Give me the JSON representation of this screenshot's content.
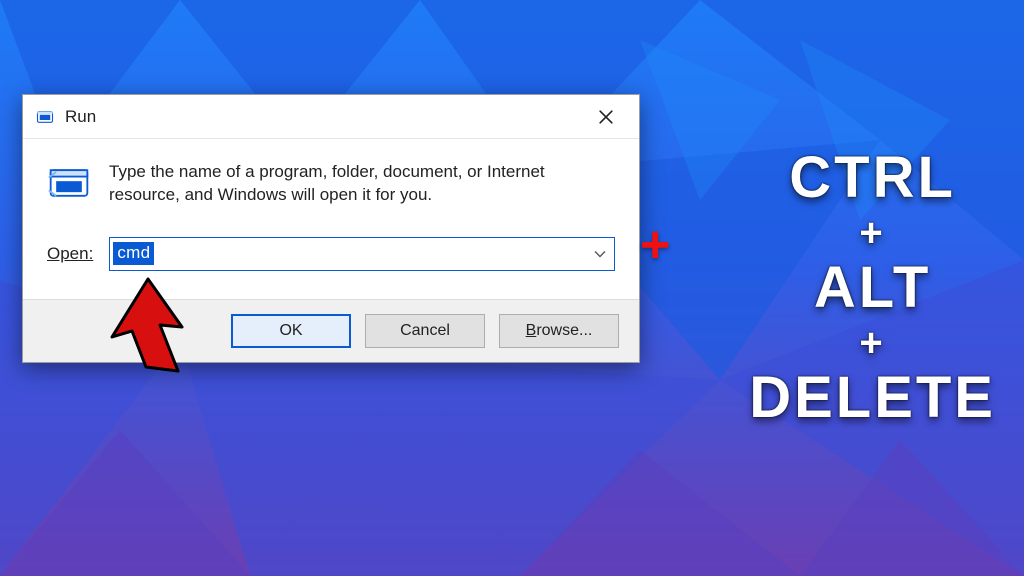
{
  "dialog": {
    "title": "Run",
    "description": "Type the name of a program, folder, document, or Internet resource, and Windows will open it for you.",
    "open_label": "Open:",
    "open_value": "cmd",
    "buttons": {
      "ok": "OK",
      "cancel": "Cancel",
      "browse": "Browse..."
    },
    "icons": {
      "title_icon": "run-icon",
      "body_icon": "run-icon",
      "close": "close-icon",
      "dropdown": "chevron-down-icon"
    }
  },
  "overlay": {
    "plus": "+",
    "ctrl": "CTRL",
    "alt": "ALT",
    "delete": "DELETE",
    "plus_sep": "+"
  },
  "colors": {
    "accent": "#0a5bd3",
    "danger": "#e11"
  }
}
